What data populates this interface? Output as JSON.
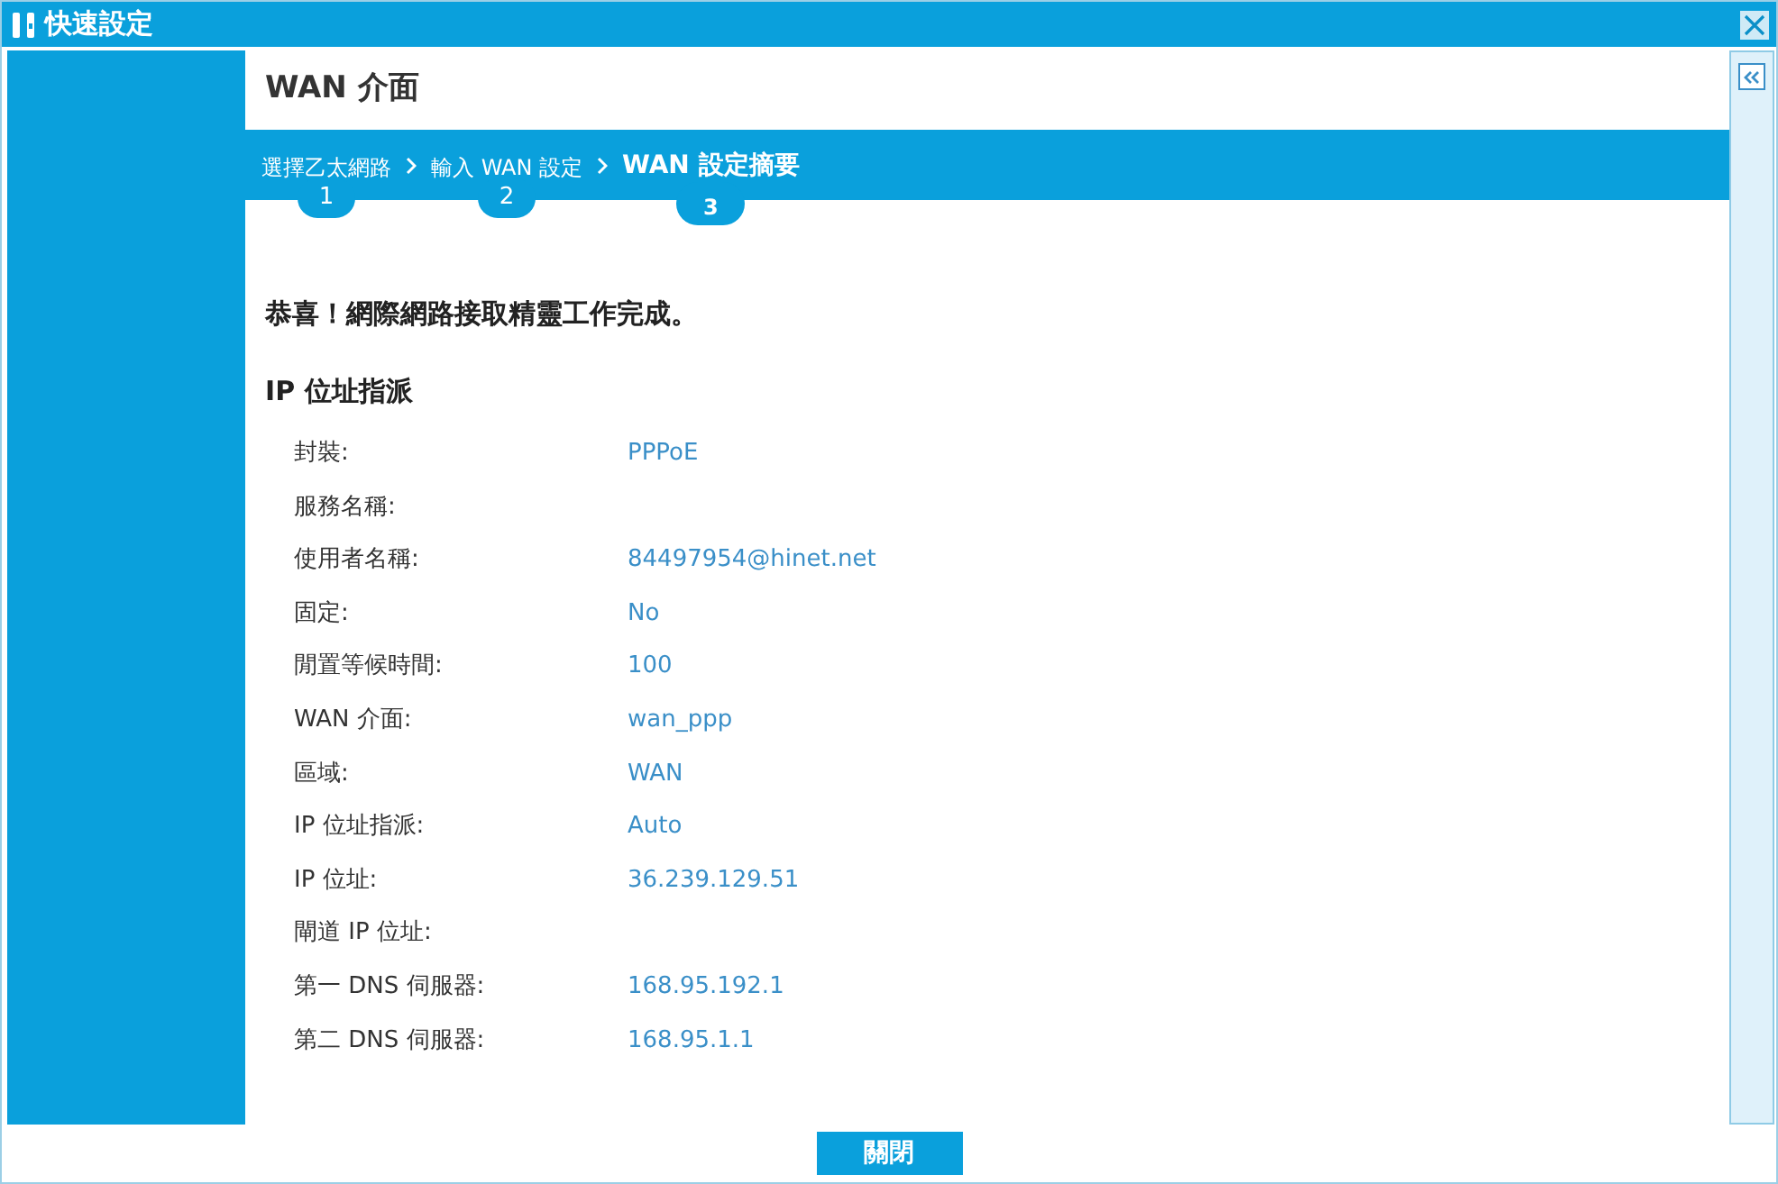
{
  "window": {
    "title": "快速設定"
  },
  "page_title": "WAN 介面",
  "steps": [
    {
      "label": "選擇乙太網路",
      "number": "1",
      "selected": false
    },
    {
      "label": "輸入 WAN 設定",
      "number": "2",
      "selected": false
    },
    {
      "label": "WAN 設定摘要",
      "number": "3",
      "selected": true
    }
  ],
  "message": "恭喜！網際網路接取精靈工作完成。",
  "section_title": "IP 位址指派",
  "fields": [
    {
      "label": "封裝:",
      "value": "PPPoE"
    },
    {
      "label": "服務名稱:"
    },
    {
      "label": "使用者名稱:",
      "value": "84497954@hinet.net"
    },
    {
      "label": "固定:",
      "value": "No"
    },
    {
      "label": "閒置等候時間:",
      "value": "100"
    },
    {
      "label": "WAN 介面:",
      "value": "wan_ppp"
    },
    {
      "label": "區域:",
      "value": "WAN"
    },
    {
      "label": "IP 位址指派:",
      "value": "Auto"
    },
    {
      "label": "IP 位址:",
      "value": "36.239.129.51"
    },
    {
      "label": "閘道 IP 位址:"
    },
    {
      "label": "第一 DNS 伺服器:",
      "value": "168.95.192.1"
    },
    {
      "label": "第二 DNS 伺服器:",
      "value": "168.95.1.1"
    }
  ],
  "close_button": "關閉"
}
